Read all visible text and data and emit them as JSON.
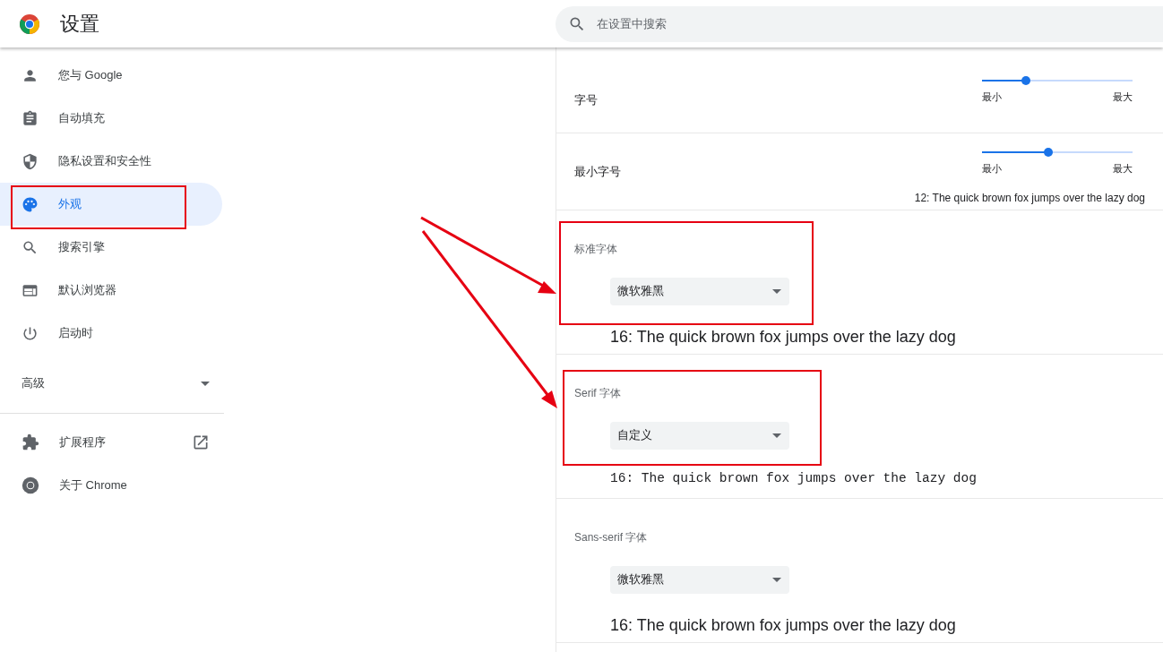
{
  "header": {
    "title": "设置",
    "search": {
      "placeholder": "在设置中搜索"
    }
  },
  "sidebar": {
    "items": [
      {
        "label": "您与 Google",
        "selected": false
      },
      {
        "label": "自动填充",
        "selected": false
      },
      {
        "label": "隐私设置和安全性",
        "selected": false
      },
      {
        "label": "外观",
        "selected": true
      },
      {
        "label": "搜索引擎",
        "selected": false
      },
      {
        "label": "默认浏览器",
        "selected": false
      },
      {
        "label": "启动时",
        "selected": false
      }
    ],
    "advanced": {
      "label": "高级",
      "expanded": false
    },
    "links": [
      {
        "label": "扩展程序",
        "external": true
      },
      {
        "label": "关于 Chrome",
        "external": false
      }
    ]
  },
  "sliders": [
    {
      "label": "字号",
      "level": 0.29,
      "min_label": "最小",
      "max_label": "最大"
    },
    {
      "label": "最小字号",
      "level": 0.44,
      "min_label": "最小",
      "max_label": "最大",
      "sample": "12: The quick brown fox jumps over the lazy dog"
    }
  ],
  "fonts": [
    {
      "label": "标准字体",
      "value": "微软雅黑",
      "kind": "sans",
      "sample": "16: The quick brown fox jumps over the lazy dog"
    },
    {
      "label": "Serif 字体",
      "value": "自定义",
      "kind": "mono",
      "sample": "16: The quick brown fox jumps over the lazy dog"
    },
    {
      "label": "Sans-serif 字体",
      "value": "微软雅黑",
      "kind": "sans",
      "sample": "16: The quick brown fox jumps over the lazy dog"
    }
  ]
}
